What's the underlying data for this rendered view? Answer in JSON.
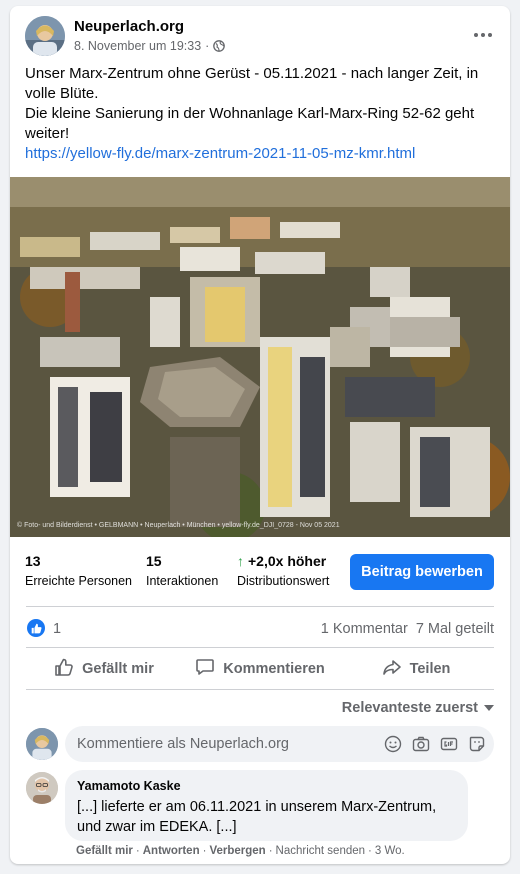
{
  "post": {
    "page_name": "Neuperlach.org",
    "timestamp": "8. November um 19:33",
    "visibility_separator": "·",
    "text_line1": "Unser Marx-Zentrum ohne Gerüst - 05.11.2021 - nach langer Zeit, in volle Blüte.",
    "text_line2": "Die kleine Sanierung in der Wohnanlage Karl-Marx-Ring 52-62 geht weiter!",
    "link": "https://yellow-fly.de/marx-zentrum-2021-11-05-mz-kmr.html",
    "photo_credit": "© Foto- und Bilderdienst • GELBMANN • Neuperlach • München • yellow-fly.de_DJI_0728 - Nov 05 2021"
  },
  "insights": {
    "reach_value": "13",
    "reach_label": "Erreichte Personen",
    "interactions_value": "15",
    "interactions_label": "Interaktionen",
    "distribution_value": "+2,0x höher",
    "distribution_label": "Distributionswert",
    "promote_button": "Beitrag bewerben"
  },
  "reactions": {
    "like_count": "1",
    "comments": "1 Kommentar",
    "shares": "7 Mal geteilt"
  },
  "actions": {
    "like": "Gefällt mir",
    "comment": "Kommentieren",
    "share": "Teilen"
  },
  "comments": {
    "sort_label": "Relevanteste zuerst",
    "input_placeholder": "Kommentiere als Neuperlach.org",
    "items": [
      {
        "author": "Yamamoto Kaske",
        "text": "[...] lieferte er am 06.11.2021 in unserem Marx-Zentrum, und zwar im EDEKA. [...]",
        "like": "Gefällt mir",
        "reply": "Antworten",
        "hide": "Verbergen",
        "message": "Nachricht senden",
        "age": "3 Wo.",
        "separator": "·"
      }
    ]
  },
  "colors": {
    "accent": "#1877f2",
    "link": "#216fdb",
    "secondary_text": "#65676b",
    "positive": "#31a24c"
  },
  "icons": [
    "globe-icon",
    "more-options-icon",
    "like-reaction-icon",
    "thumbs-up-icon",
    "comment-icon",
    "share-icon",
    "emoji-icon",
    "camera-icon",
    "gif-icon",
    "sticker-icon"
  ]
}
